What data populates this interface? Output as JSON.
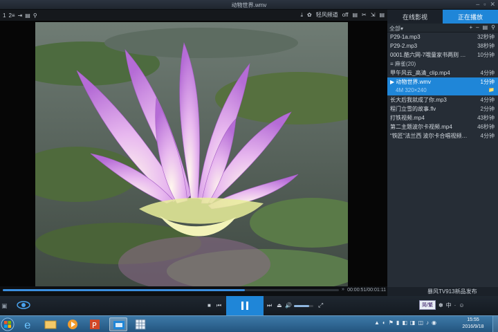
{
  "window": {
    "title": "动物世界.wmv"
  },
  "toolbar": {
    "left_icons": [
      "1",
      "2≡",
      "⇥",
      "▤",
      "⚲"
    ],
    "download_icon": "⤓",
    "breeze_label": "轻风频道",
    "breeze_state": "off",
    "right_icons": [
      "▤",
      "✂",
      "⇲",
      "▤"
    ]
  },
  "window_buttons": [
    "–",
    "▫",
    "✕"
  ],
  "sidebar": {
    "tabs": [
      "在线影视",
      "正在播放"
    ],
    "all_label": "全部▾",
    "head_icons": [
      "+",
      "–",
      "▤",
      "⚲"
    ],
    "playlist": [
      {
        "name": "P29-1a.mp3",
        "duration": "32秒钟"
      },
      {
        "name": "P29-2.mp3",
        "duration": "38秒钟"
      },
      {
        "name": "0001.酷六网-7哦童家书两则 范…",
        "duration": "10分钟"
      },
      {
        "name": "≡ 麻雀(20)",
        "duration": "",
        "group": true
      },
      {
        "name": "甲午风云_高清_clip.mp4",
        "duration": "4分钟"
      }
    ],
    "selected": {
      "name": "▶ 动物世界.wmv",
      "duration": "1分钟",
      "details": "4M   320×240",
      "folder_icon": "📁"
    },
    "playlist_after": [
      {
        "name": "长大后我就成了你.mp3",
        "duration": "4分钟"
      },
      {
        "name": "程门立雪的故事.flv",
        "duration": "2分钟"
      },
      {
        "name": "打铁视频.mp4",
        "duration": "43秒钟"
      },
      {
        "name": "第二主题波尔卡视频.mp4",
        "duration": "46秒钟"
      },
      {
        "name": "“铁匠”法兰西 波尔卡合唱视频…",
        "duration": "4分钟"
      }
    ],
    "footer": "暴风TV913新品发布"
  },
  "playback": {
    "time": "00:00:51/00:01:11",
    "progress": 0.72,
    "volume": 0.8
  },
  "controls": {
    "stop": "■",
    "prev": "⏮",
    "next": "⏭",
    "eject": "⏏",
    "volume": "🔊",
    "fullscreen": "⤢",
    "ime_label": "简/繁",
    "ime_icons": [
      "中",
      "·",
      "☺"
    ]
  },
  "taskbar": {
    "clock_time": "15:55",
    "clock_date": "2016/9/18",
    "tray_icons": [
      "▲",
      "◐",
      "⚑",
      "▮",
      "◧",
      "◨",
      "◫",
      "♪",
      "◉",
      "EN"
    ]
  }
}
